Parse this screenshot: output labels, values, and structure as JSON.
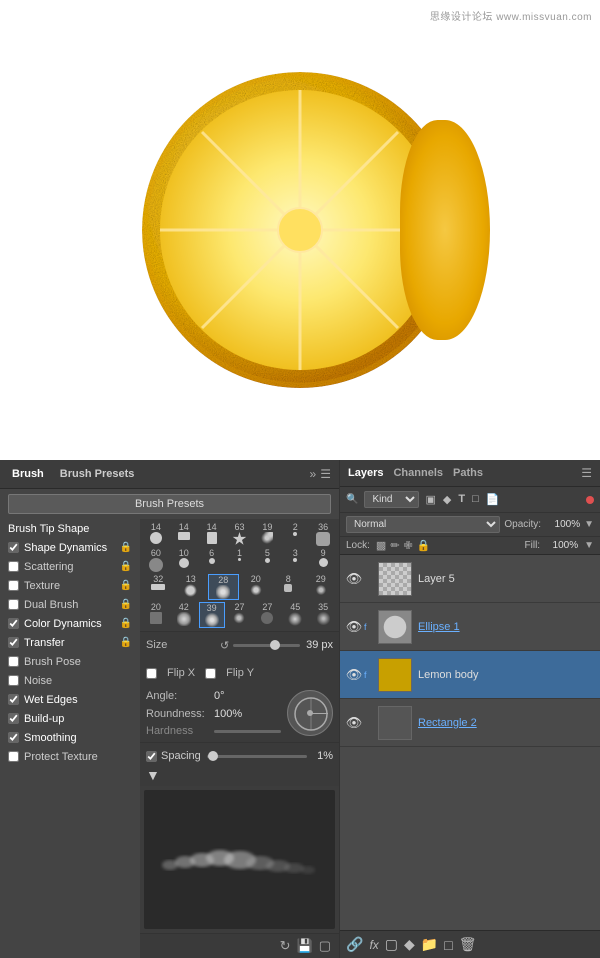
{
  "watermark": "思缘设计论坛 www.missvuan.com",
  "brush_panel": {
    "tabs": [
      {
        "label": "Brush",
        "active": true
      },
      {
        "label": "Brush Presets",
        "active": false
      }
    ],
    "presets_btn": "Brush Presets",
    "tip_shape_label": "Brush Tip Shape",
    "options": [
      {
        "label": "Shape Dynamics",
        "checked": true,
        "lock": true
      },
      {
        "label": "Scattering",
        "checked": false,
        "lock": true
      },
      {
        "label": "Texture",
        "checked": false,
        "lock": true
      },
      {
        "label": "Dual Brush",
        "checked": false,
        "lock": true
      },
      {
        "label": "Color Dynamics",
        "checked": true,
        "lock": true
      },
      {
        "label": "Transfer",
        "checked": true,
        "lock": true
      },
      {
        "label": "Brush Pose",
        "checked": false,
        "lock": false
      },
      {
        "label": "Noise",
        "checked": false,
        "lock": false
      },
      {
        "label": "Wet Edges",
        "checked": true,
        "lock": false
      },
      {
        "label": "Build-up",
        "checked": true,
        "lock": false
      },
      {
        "label": "Smoothing",
        "checked": true,
        "lock": false
      },
      {
        "label": "Protect Texture",
        "checked": false,
        "lock": false
      }
    ],
    "tip_sizes_row1": [
      "14",
      "14",
      "14",
      "63",
      "19",
      "2",
      "36"
    ],
    "tip_sizes_row2": [
      "60",
      "10",
      "6",
      "1",
      "5",
      "3",
      "9"
    ],
    "tip_sizes_row3": [
      "32",
      "13",
      "28",
      "20",
      "8",
      "29"
    ],
    "tip_sizes_row4": [
      "20",
      "42",
      "39",
      "27",
      "27",
      "45",
      "35"
    ],
    "size_label": "Size",
    "size_value": "39 px",
    "flip_x": "Flip X",
    "flip_y": "Flip Y",
    "angle_label": "Angle:",
    "angle_value": "0°",
    "roundness_label": "Roundness:",
    "roundness_value": "100%",
    "hardness_label": "Hardness",
    "spacing_label": "Spacing",
    "spacing_value": "1%"
  },
  "layers_panel": {
    "tabs": [
      {
        "label": "Layers",
        "active": true
      },
      {
        "label": "Channels",
        "active": false
      },
      {
        "label": "Paths",
        "active": false
      }
    ],
    "kind_label": "Kind",
    "blend_mode": "Normal",
    "opacity_label": "Opacity:",
    "opacity_value": "100%",
    "lock_label": "Lock:",
    "fill_label": "Fill:",
    "fill_value": "100%",
    "layers": [
      {
        "name": "Layer 5",
        "visible": true,
        "thumb_color": "#888",
        "selected": false,
        "linked": false
      },
      {
        "name": "Ellipse 1",
        "visible": true,
        "thumb_color": "#aaa",
        "selected": false,
        "linked": true
      },
      {
        "name": "Lemon body",
        "visible": true,
        "thumb_color": "#c8a000",
        "selected": true,
        "linked": false
      },
      {
        "name": "Rectangle 2",
        "visible": true,
        "thumb_color": "#555",
        "selected": false,
        "linked": false
      }
    ],
    "bottom_icons": [
      "link",
      "fx",
      "new-layer",
      "adjust",
      "folder",
      "copy",
      "delete"
    ]
  }
}
